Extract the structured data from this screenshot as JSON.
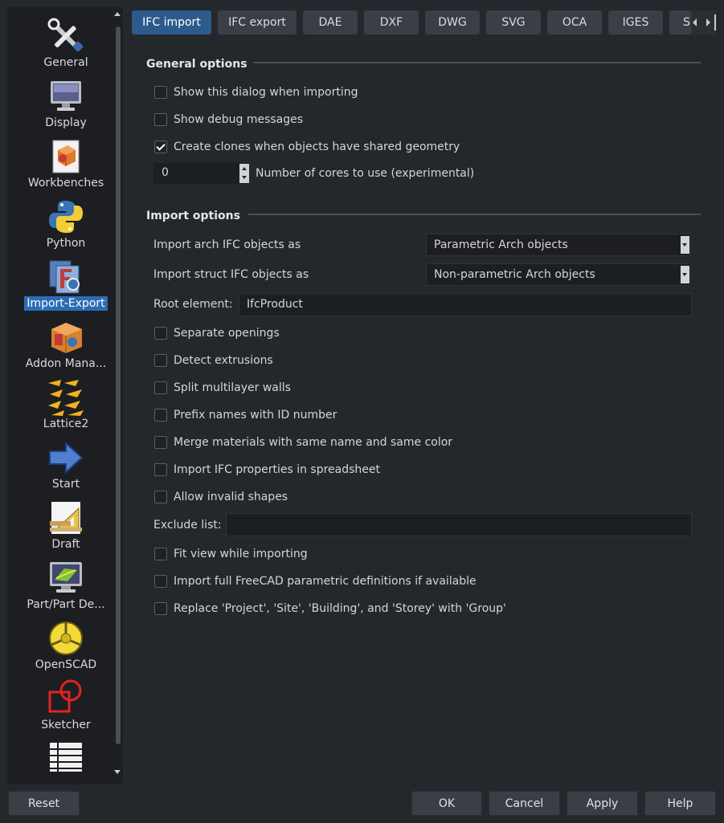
{
  "sidebar": {
    "items": [
      {
        "label": "General",
        "icon": "tools-icon"
      },
      {
        "label": "Display",
        "icon": "monitor-icon"
      },
      {
        "label": "Workbenches",
        "icon": "workbench-box-icon"
      },
      {
        "label": "Python",
        "icon": "python-icon"
      },
      {
        "label": "Import-Export",
        "icon": "import-export-icon"
      },
      {
        "label": "Addon Mana...",
        "icon": "addon-manager-icon"
      },
      {
        "label": "Lattice2",
        "icon": "lattice-icon"
      },
      {
        "label": "Start",
        "icon": "arrow-right-icon"
      },
      {
        "label": "Draft",
        "icon": "draft-icon"
      },
      {
        "label": "Part/Part De...",
        "icon": "part-design-icon"
      },
      {
        "label": "OpenSCAD",
        "icon": "openscad-icon"
      },
      {
        "label": "Sketcher",
        "icon": "sketcher-icon"
      },
      {
        "label": "",
        "icon": "spreadsheet-icon"
      }
    ],
    "selected": "Import-Export"
  },
  "tabs": [
    {
      "label": "IFC import"
    },
    {
      "label": "IFC export"
    },
    {
      "label": "DAE"
    },
    {
      "label": "DXF"
    },
    {
      "label": "DWG"
    },
    {
      "label": "SVG"
    },
    {
      "label": "OCA"
    },
    {
      "label": "IGES"
    },
    {
      "label": "S"
    }
  ],
  "general": {
    "title": "General options",
    "show_dialog": {
      "label": "Show this dialog when importing",
      "checked": false
    },
    "show_debug": {
      "label": "Show debug messages",
      "checked": false
    },
    "create_clones": {
      "label": "Create clones when objects have shared geometry",
      "checked": true
    },
    "cores_value": "0",
    "cores_label": "Number of cores to use (experimental)"
  },
  "import": {
    "title": "Import options",
    "arch_label": "Import arch IFC objects as",
    "arch_value": "Parametric Arch objects",
    "struct_label": "Import struct IFC objects as",
    "struct_value": "Non-parametric Arch objects",
    "root_label": "Root element:",
    "root_value": "IfcProduct",
    "separate_openings": "Separate openings",
    "detect_extrusions": "Detect extrusions",
    "split_walls": "Split multilayer walls",
    "prefix_names": "Prefix names with ID number",
    "merge_materials": "Merge materials with same name and same color",
    "ifc_props": "Import IFC properties in spreadsheet",
    "allow_invalid": "Allow invalid shapes",
    "exclude_label": "Exclude list:",
    "exclude_value": "",
    "fit_view": "Fit view while importing",
    "full_param": "Import full FreeCAD parametric definitions if available",
    "replace_group": "Replace 'Project', 'Site', 'Building', and 'Storey' with 'Group'"
  },
  "buttons": {
    "reset": "Reset",
    "ok": "OK",
    "cancel": "Cancel",
    "apply": "Apply",
    "help": "Help"
  },
  "colors": {
    "background": "#24272c",
    "accent": "#2d5a8c",
    "selection": "#2b6db5"
  }
}
